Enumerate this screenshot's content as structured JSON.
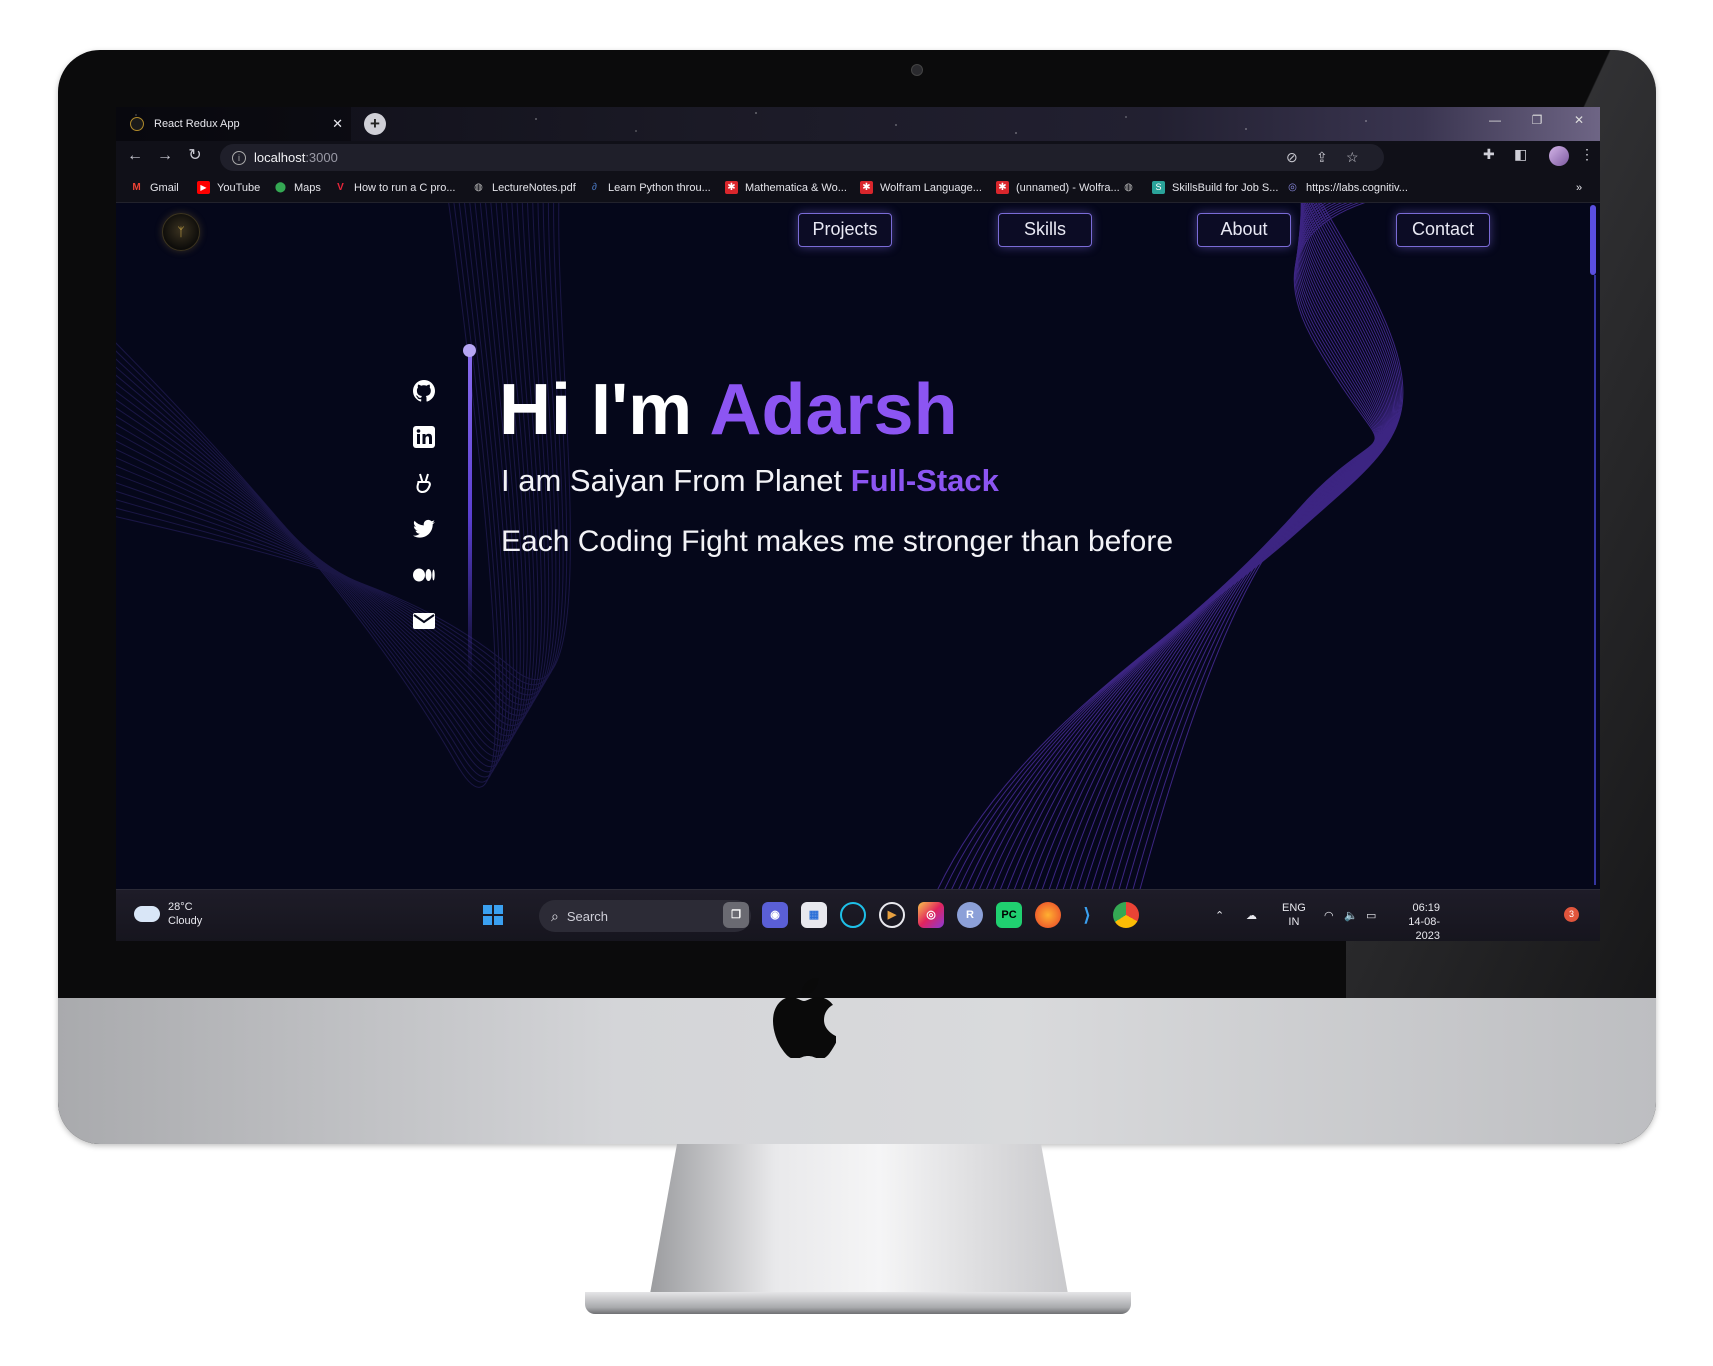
{
  "browser": {
    "tab_title": "React Redux App",
    "tab_close": "✕",
    "new_tab": "+",
    "url_host": "localhost",
    "url_port": ":3000",
    "bookmarks": [
      {
        "label": "Gmail",
        "icon": "gmail-icon",
        "color": "#ea4335"
      },
      {
        "label": "YouTube",
        "icon": "youtube-icon",
        "color": "#ff0000"
      },
      {
        "label": "Maps",
        "icon": "maps-icon",
        "color": "#34a853"
      },
      {
        "label": "How to run a C pro...",
        "icon": "v-icon",
        "color": "#e8263a"
      },
      {
        "label": "LectureNotes.pdf",
        "icon": "globe-icon",
        "color": "#9a9aa6"
      },
      {
        "label": "Learn Python throu...",
        "icon": "python-icon",
        "color": "#4a78c2"
      },
      {
        "label": "Mathematica & Wo...",
        "icon": "wolfram-icon",
        "color": "#d9262c"
      },
      {
        "label": "Wolfram Language...",
        "icon": "wolfram-icon",
        "color": "#d9262c"
      },
      {
        "label": "(unnamed) - Wolfra...",
        "icon": "wolfram-icon",
        "color": "#d9262c"
      },
      {
        "label": "",
        "icon": "globe-icon",
        "color": "#9a9aa6"
      },
      {
        "label": "SkillsBuild for Job S...",
        "icon": "skillsbuild-icon",
        "color": "#2aa39a"
      },
      {
        "label": "https://labs.cognitiv...",
        "icon": "cognitive-icon",
        "color": "#6a6ad0"
      }
    ],
    "bookmarks_overflow": "»"
  },
  "site": {
    "logo_glyph": "ᛉ",
    "nav": [
      "Projects",
      "Skills",
      "About",
      "Contact"
    ],
    "socials": [
      "github-icon",
      "linkedin-icon",
      "angellist-icon",
      "twitter-icon",
      "medium-icon",
      "mail-icon"
    ],
    "hero": {
      "greeting": "Hi I'm ",
      "name": "Adarsh",
      "sub_prefix": "I am Saiyan From Planet ",
      "sub_accent": "Full-Stack",
      "tagline": "Each Coding Fight makes me stronger than before"
    },
    "colors": {
      "accent": "#8c55f2",
      "background": "#05071a",
      "nav_border": "#7a6bd6"
    }
  },
  "taskbar": {
    "weather_temp": "28°C",
    "weather_desc": "Cloudy",
    "search_placeholder": "Search",
    "lang_top": "ENG",
    "lang_bottom": "IN",
    "time": "06:19",
    "date": "14-08-2023",
    "notifications": "3",
    "apps": [
      "windows-start-icon",
      "bing-icon",
      "task-view-icon",
      "meet-icon",
      "store-icon",
      "cortana-icon",
      "media-player-icon",
      "instagram-icon",
      "r-icon",
      "pycharm-icon",
      "firefox-icon",
      "vscode-icon",
      "chrome-icon"
    ]
  }
}
